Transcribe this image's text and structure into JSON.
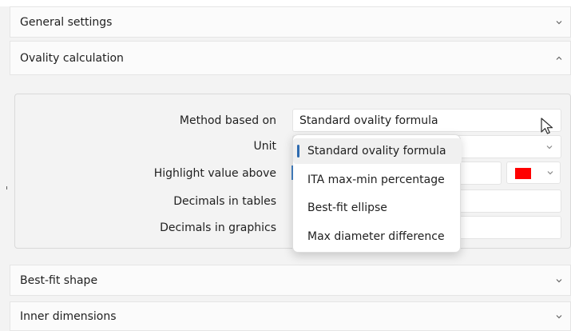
{
  "sections": {
    "general": "General settings",
    "ovality": "Ovality calculation",
    "best_fit": "Best-fit shape",
    "inner": "Inner dimensions"
  },
  "form": {
    "labels": {
      "method": "Method based on",
      "unit": "Unit",
      "highlight": "Highlight value above",
      "decimals_tables": "Decimals in tables",
      "decimals_graphics": "Decimals in graphics"
    },
    "values": {
      "method": "Standard ovality formula"
    }
  },
  "dropdown": {
    "options": [
      "Standard ovality formula",
      "ITA max-min percentage",
      "Best-fit ellipse",
      "Max diameter difference"
    ],
    "selected_index": 0
  },
  "colors": {
    "highlight_swatch": "#ff0000",
    "accent": "#2e6bb0"
  },
  "icons": {
    "collapsed": "chevron-down-icon",
    "expanded": "chevron-up-icon",
    "cursor": "pointer-cursor-icon"
  }
}
